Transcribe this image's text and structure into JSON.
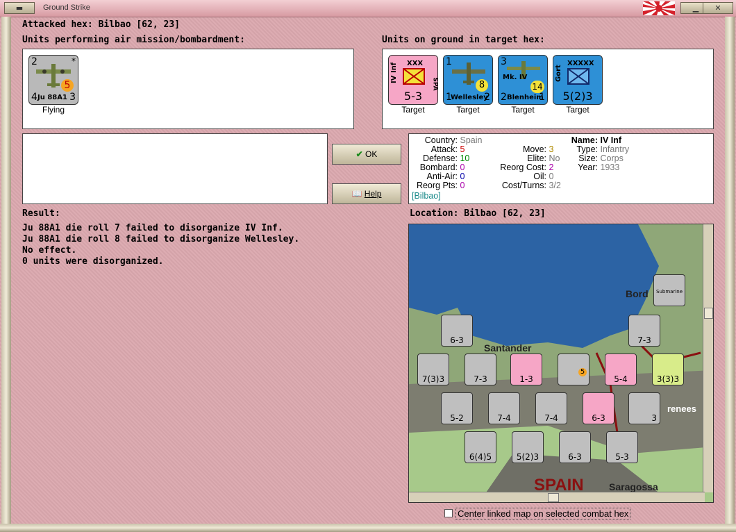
{
  "window": {
    "title": "Ground Strike"
  },
  "header": {
    "attacked_hex": "Attacked hex: Bilbao  [62, 23]"
  },
  "air_units": {
    "label": "Units performing air mission/bombardment:",
    "items": [
      {
        "name": "Ju 88A1",
        "left": "2",
        "bottom_left": "4",
        "bottom_right": "3",
        "strength": "5",
        "status": "Flying"
      }
    ]
  },
  "ground_units": {
    "label": "Units on ground in target hex:",
    "items": [
      {
        "name": "IV Inf",
        "size": "XXX",
        "side": "SPA",
        "value": "5-3",
        "status": "Target",
        "color": "#f6a6c6"
      },
      {
        "name": "Wellesley",
        "left": "1",
        "bottom_left": "1",
        "bottom_right": "2",
        "strength": "8",
        "status": "Target",
        "color": "#2e90d6"
      },
      {
        "name": "Blenheim",
        "sub": "Mk. IV",
        "left": "3",
        "bottom_left": "2",
        "bottom_right": "1",
        "strength": "14",
        "status": "Target",
        "color": "#2e90d6"
      },
      {
        "name": "Gort",
        "size": "XXXXX",
        "value": "5(2)3",
        "status": "Target",
        "color": "#2e90d6"
      }
    ]
  },
  "buttons": {
    "ok": "OK",
    "help": "Help"
  },
  "info": {
    "country_k": "Country:",
    "country_v": "Spain",
    "attack_k": "Attack:",
    "attack_v": "5",
    "defense_k": "Defense:",
    "defense_v": "10",
    "bombard_k": "Bombard:",
    "bombard_v": "0",
    "antiair_k": "Anti-Air:",
    "antiair_v": "0",
    "reorgpts_k": "Reorg Pts:",
    "reorgpts_v": "0",
    "location_link": "[Bilbao]",
    "move_k": "Move:",
    "move_v": "3",
    "elite_k": "Elite:",
    "elite_v": "No",
    "reorgcost_k": "Reorg Cost:",
    "reorgcost_v": "2",
    "oil_k": "Oil:",
    "oil_v": "0",
    "costturns_k": "Cost/Turns:",
    "costturns_v": "3/2",
    "name_k": "Name:",
    "name_v": "IV Inf",
    "type_k": "Type:",
    "type_v": "Infantry",
    "size_k": "Size:",
    "size_v": "Corps",
    "year_k": "Year:",
    "year_v": "1933"
  },
  "result": {
    "label": "Result:",
    "lines": [
      "Ju 88A1 die roll 7 failed to disorganize IV Inf.",
      "Ju 88A1 die roll 8 failed to disorganize Wellesley.",
      "No effect.",
      "0 units were disorganized."
    ]
  },
  "location": {
    "label": "Location:  Bilbao  [62, 23]"
  },
  "map": {
    "places": [
      "Bord",
      "Santander",
      "Saragossa",
      "SPAIN",
      "renees"
    ],
    "counters": [
      {
        "v": "6-3"
      },
      {
        "v": "7-3"
      },
      {
        "v": "7(3)3"
      },
      {
        "v": "7-3"
      },
      {
        "v": "1-3"
      },
      {
        "v": "5"
      },
      {
        "v": "5-4"
      },
      {
        "v": "3(3)3"
      },
      {
        "v": "5-2"
      },
      {
        "v": "7-4"
      },
      {
        "v": "7-4"
      },
      {
        "v": "6-3"
      },
      {
        "v": "3"
      },
      {
        "v": "6(4)5"
      },
      {
        "v": "5(2)3"
      },
      {
        "v": "6-3"
      },
      {
        "v": "5-3"
      },
      {
        "v": "Submarine"
      }
    ]
  },
  "footer": {
    "center_map": "Center linked map on selected combat hex"
  }
}
